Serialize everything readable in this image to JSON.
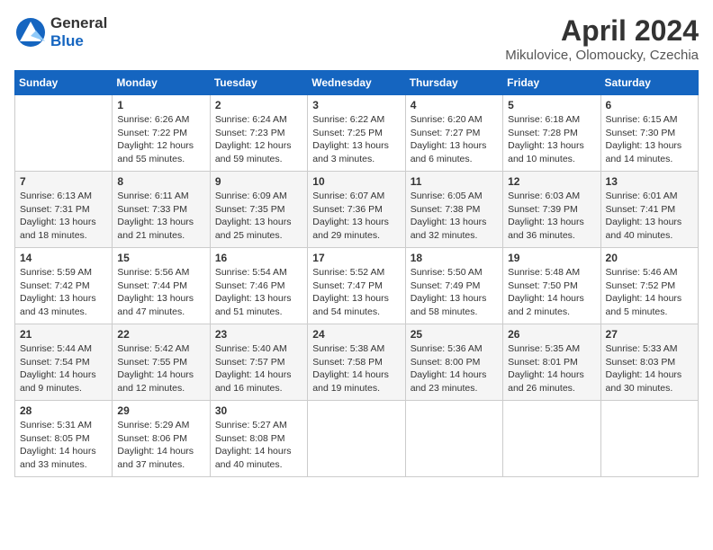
{
  "header": {
    "logo_general": "General",
    "logo_blue": "Blue",
    "month": "April 2024",
    "location": "Mikulovice, Olomoucky, Czechia"
  },
  "weekdays": [
    "Sunday",
    "Monday",
    "Tuesday",
    "Wednesday",
    "Thursday",
    "Friday",
    "Saturday"
  ],
  "weeks": [
    [
      {
        "day": "",
        "sunrise": "",
        "sunset": "",
        "daylight": ""
      },
      {
        "day": "1",
        "sunrise": "Sunrise: 6:26 AM",
        "sunset": "Sunset: 7:22 PM",
        "daylight": "Daylight: 12 hours and 55 minutes."
      },
      {
        "day": "2",
        "sunrise": "Sunrise: 6:24 AM",
        "sunset": "Sunset: 7:23 PM",
        "daylight": "Daylight: 12 hours and 59 minutes."
      },
      {
        "day": "3",
        "sunrise": "Sunrise: 6:22 AM",
        "sunset": "Sunset: 7:25 PM",
        "daylight": "Daylight: 13 hours and 3 minutes."
      },
      {
        "day": "4",
        "sunrise": "Sunrise: 6:20 AM",
        "sunset": "Sunset: 7:27 PM",
        "daylight": "Daylight: 13 hours and 6 minutes."
      },
      {
        "day": "5",
        "sunrise": "Sunrise: 6:18 AM",
        "sunset": "Sunset: 7:28 PM",
        "daylight": "Daylight: 13 hours and 10 minutes."
      },
      {
        "day": "6",
        "sunrise": "Sunrise: 6:15 AM",
        "sunset": "Sunset: 7:30 PM",
        "daylight": "Daylight: 13 hours and 14 minutes."
      }
    ],
    [
      {
        "day": "7",
        "sunrise": "Sunrise: 6:13 AM",
        "sunset": "Sunset: 7:31 PM",
        "daylight": "Daylight: 13 hours and 18 minutes."
      },
      {
        "day": "8",
        "sunrise": "Sunrise: 6:11 AM",
        "sunset": "Sunset: 7:33 PM",
        "daylight": "Daylight: 13 hours and 21 minutes."
      },
      {
        "day": "9",
        "sunrise": "Sunrise: 6:09 AM",
        "sunset": "Sunset: 7:35 PM",
        "daylight": "Daylight: 13 hours and 25 minutes."
      },
      {
        "day": "10",
        "sunrise": "Sunrise: 6:07 AM",
        "sunset": "Sunset: 7:36 PM",
        "daylight": "Daylight: 13 hours and 29 minutes."
      },
      {
        "day": "11",
        "sunrise": "Sunrise: 6:05 AM",
        "sunset": "Sunset: 7:38 PM",
        "daylight": "Daylight: 13 hours and 32 minutes."
      },
      {
        "day": "12",
        "sunrise": "Sunrise: 6:03 AM",
        "sunset": "Sunset: 7:39 PM",
        "daylight": "Daylight: 13 hours and 36 minutes."
      },
      {
        "day": "13",
        "sunrise": "Sunrise: 6:01 AM",
        "sunset": "Sunset: 7:41 PM",
        "daylight": "Daylight: 13 hours and 40 minutes."
      }
    ],
    [
      {
        "day": "14",
        "sunrise": "Sunrise: 5:59 AM",
        "sunset": "Sunset: 7:42 PM",
        "daylight": "Daylight: 13 hours and 43 minutes."
      },
      {
        "day": "15",
        "sunrise": "Sunrise: 5:56 AM",
        "sunset": "Sunset: 7:44 PM",
        "daylight": "Daylight: 13 hours and 47 minutes."
      },
      {
        "day": "16",
        "sunrise": "Sunrise: 5:54 AM",
        "sunset": "Sunset: 7:46 PM",
        "daylight": "Daylight: 13 hours and 51 minutes."
      },
      {
        "day": "17",
        "sunrise": "Sunrise: 5:52 AM",
        "sunset": "Sunset: 7:47 PM",
        "daylight": "Daylight: 13 hours and 54 minutes."
      },
      {
        "day": "18",
        "sunrise": "Sunrise: 5:50 AM",
        "sunset": "Sunset: 7:49 PM",
        "daylight": "Daylight: 13 hours and 58 minutes."
      },
      {
        "day": "19",
        "sunrise": "Sunrise: 5:48 AM",
        "sunset": "Sunset: 7:50 PM",
        "daylight": "Daylight: 14 hours and 2 minutes."
      },
      {
        "day": "20",
        "sunrise": "Sunrise: 5:46 AM",
        "sunset": "Sunset: 7:52 PM",
        "daylight": "Daylight: 14 hours and 5 minutes."
      }
    ],
    [
      {
        "day": "21",
        "sunrise": "Sunrise: 5:44 AM",
        "sunset": "Sunset: 7:54 PM",
        "daylight": "Daylight: 14 hours and 9 minutes."
      },
      {
        "day": "22",
        "sunrise": "Sunrise: 5:42 AM",
        "sunset": "Sunset: 7:55 PM",
        "daylight": "Daylight: 14 hours and 12 minutes."
      },
      {
        "day": "23",
        "sunrise": "Sunrise: 5:40 AM",
        "sunset": "Sunset: 7:57 PM",
        "daylight": "Daylight: 14 hours and 16 minutes."
      },
      {
        "day": "24",
        "sunrise": "Sunrise: 5:38 AM",
        "sunset": "Sunset: 7:58 PM",
        "daylight": "Daylight: 14 hours and 19 minutes."
      },
      {
        "day": "25",
        "sunrise": "Sunrise: 5:36 AM",
        "sunset": "Sunset: 8:00 PM",
        "daylight": "Daylight: 14 hours and 23 minutes."
      },
      {
        "day": "26",
        "sunrise": "Sunrise: 5:35 AM",
        "sunset": "Sunset: 8:01 PM",
        "daylight": "Daylight: 14 hours and 26 minutes."
      },
      {
        "day": "27",
        "sunrise": "Sunrise: 5:33 AM",
        "sunset": "Sunset: 8:03 PM",
        "daylight": "Daylight: 14 hours and 30 minutes."
      }
    ],
    [
      {
        "day": "28",
        "sunrise": "Sunrise: 5:31 AM",
        "sunset": "Sunset: 8:05 PM",
        "daylight": "Daylight: 14 hours and 33 minutes."
      },
      {
        "day": "29",
        "sunrise": "Sunrise: 5:29 AM",
        "sunset": "Sunset: 8:06 PM",
        "daylight": "Daylight: 14 hours and 37 minutes."
      },
      {
        "day": "30",
        "sunrise": "Sunrise: 5:27 AM",
        "sunset": "Sunset: 8:08 PM",
        "daylight": "Daylight: 14 hours and 40 minutes."
      },
      {
        "day": "",
        "sunrise": "",
        "sunset": "",
        "daylight": ""
      },
      {
        "day": "",
        "sunrise": "",
        "sunset": "",
        "daylight": ""
      },
      {
        "day": "",
        "sunrise": "",
        "sunset": "",
        "daylight": ""
      },
      {
        "day": "",
        "sunrise": "",
        "sunset": "",
        "daylight": ""
      }
    ]
  ]
}
